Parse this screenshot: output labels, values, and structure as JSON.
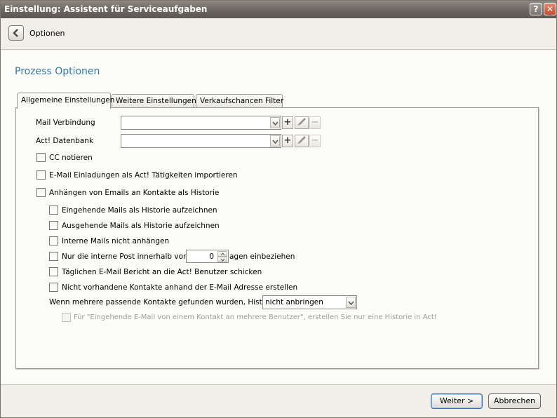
{
  "window": {
    "title": "Einstellung: Assistent für Serviceaufgaben",
    "help_glyph": "?",
    "close_glyph": "✕"
  },
  "nav": {
    "back_icon": "back-arrow-icon",
    "label": "Optionen"
  },
  "section_title": "Prozess Optionen",
  "tabs": [
    {
      "label": "Allgemeine Einstellungen",
      "active": true
    },
    {
      "label": "Weitere Einstellungen",
      "active": false
    },
    {
      "label": "Verkaufschancen Filter",
      "active": false
    }
  ],
  "form": {
    "mail_connection": {
      "label": "Mail Verbindung",
      "value": ""
    },
    "act_database": {
      "label": "Act! Datenbank",
      "value": ""
    },
    "add_glyph": "+",
    "remove_glyph": "−",
    "checkboxes": {
      "cc": {
        "label": "CC notieren",
        "checked": false
      },
      "email_invites": {
        "label": "E-Mail Einladungen als Act! Tätigkeiten importieren",
        "checked": false
      },
      "attach_history": {
        "label": "Anhängen von Emails an Kontakte als Historie",
        "checked": false
      },
      "incoming": {
        "label": "Eingehende Mails als Historie aufzeichnen",
        "checked": false
      },
      "outgoing": {
        "label": "Ausgehende Mails als Historie aufzeichnen",
        "checked": false
      },
      "internal": {
        "label": "Interne Mails nicht anhängen",
        "checked": false
      },
      "internal_post_prefix": {
        "label": "Nur die interne Post innerhalb von",
        "checked": false
      },
      "internal_post_suffix": "agen einbeziehen",
      "daily_report": {
        "label": "Täglichen E-Mail Bericht an die Act! Benutzer schicken",
        "checked": false
      },
      "create_contacts": {
        "label": "Nicht vorhandene Kontakte anhand der E-Mail Adresse erstellen",
        "checked": false
      },
      "multiple_users": {
        "label": "Für \"Eingehende E-Mail von einem Kontakt an mehrere Benutzer\", erstellen Sie nur eine Historie in Act!",
        "checked": false,
        "disabled": true
      }
    },
    "days_value": "0",
    "multiple_contacts_label": "Wenn mehrere passende Kontakte gefunden wurden, Historie",
    "multiple_contacts_value": "nicht anbringen"
  },
  "footer": {
    "next_label": "Weiter >",
    "cancel_label": "Abbrechen"
  }
}
